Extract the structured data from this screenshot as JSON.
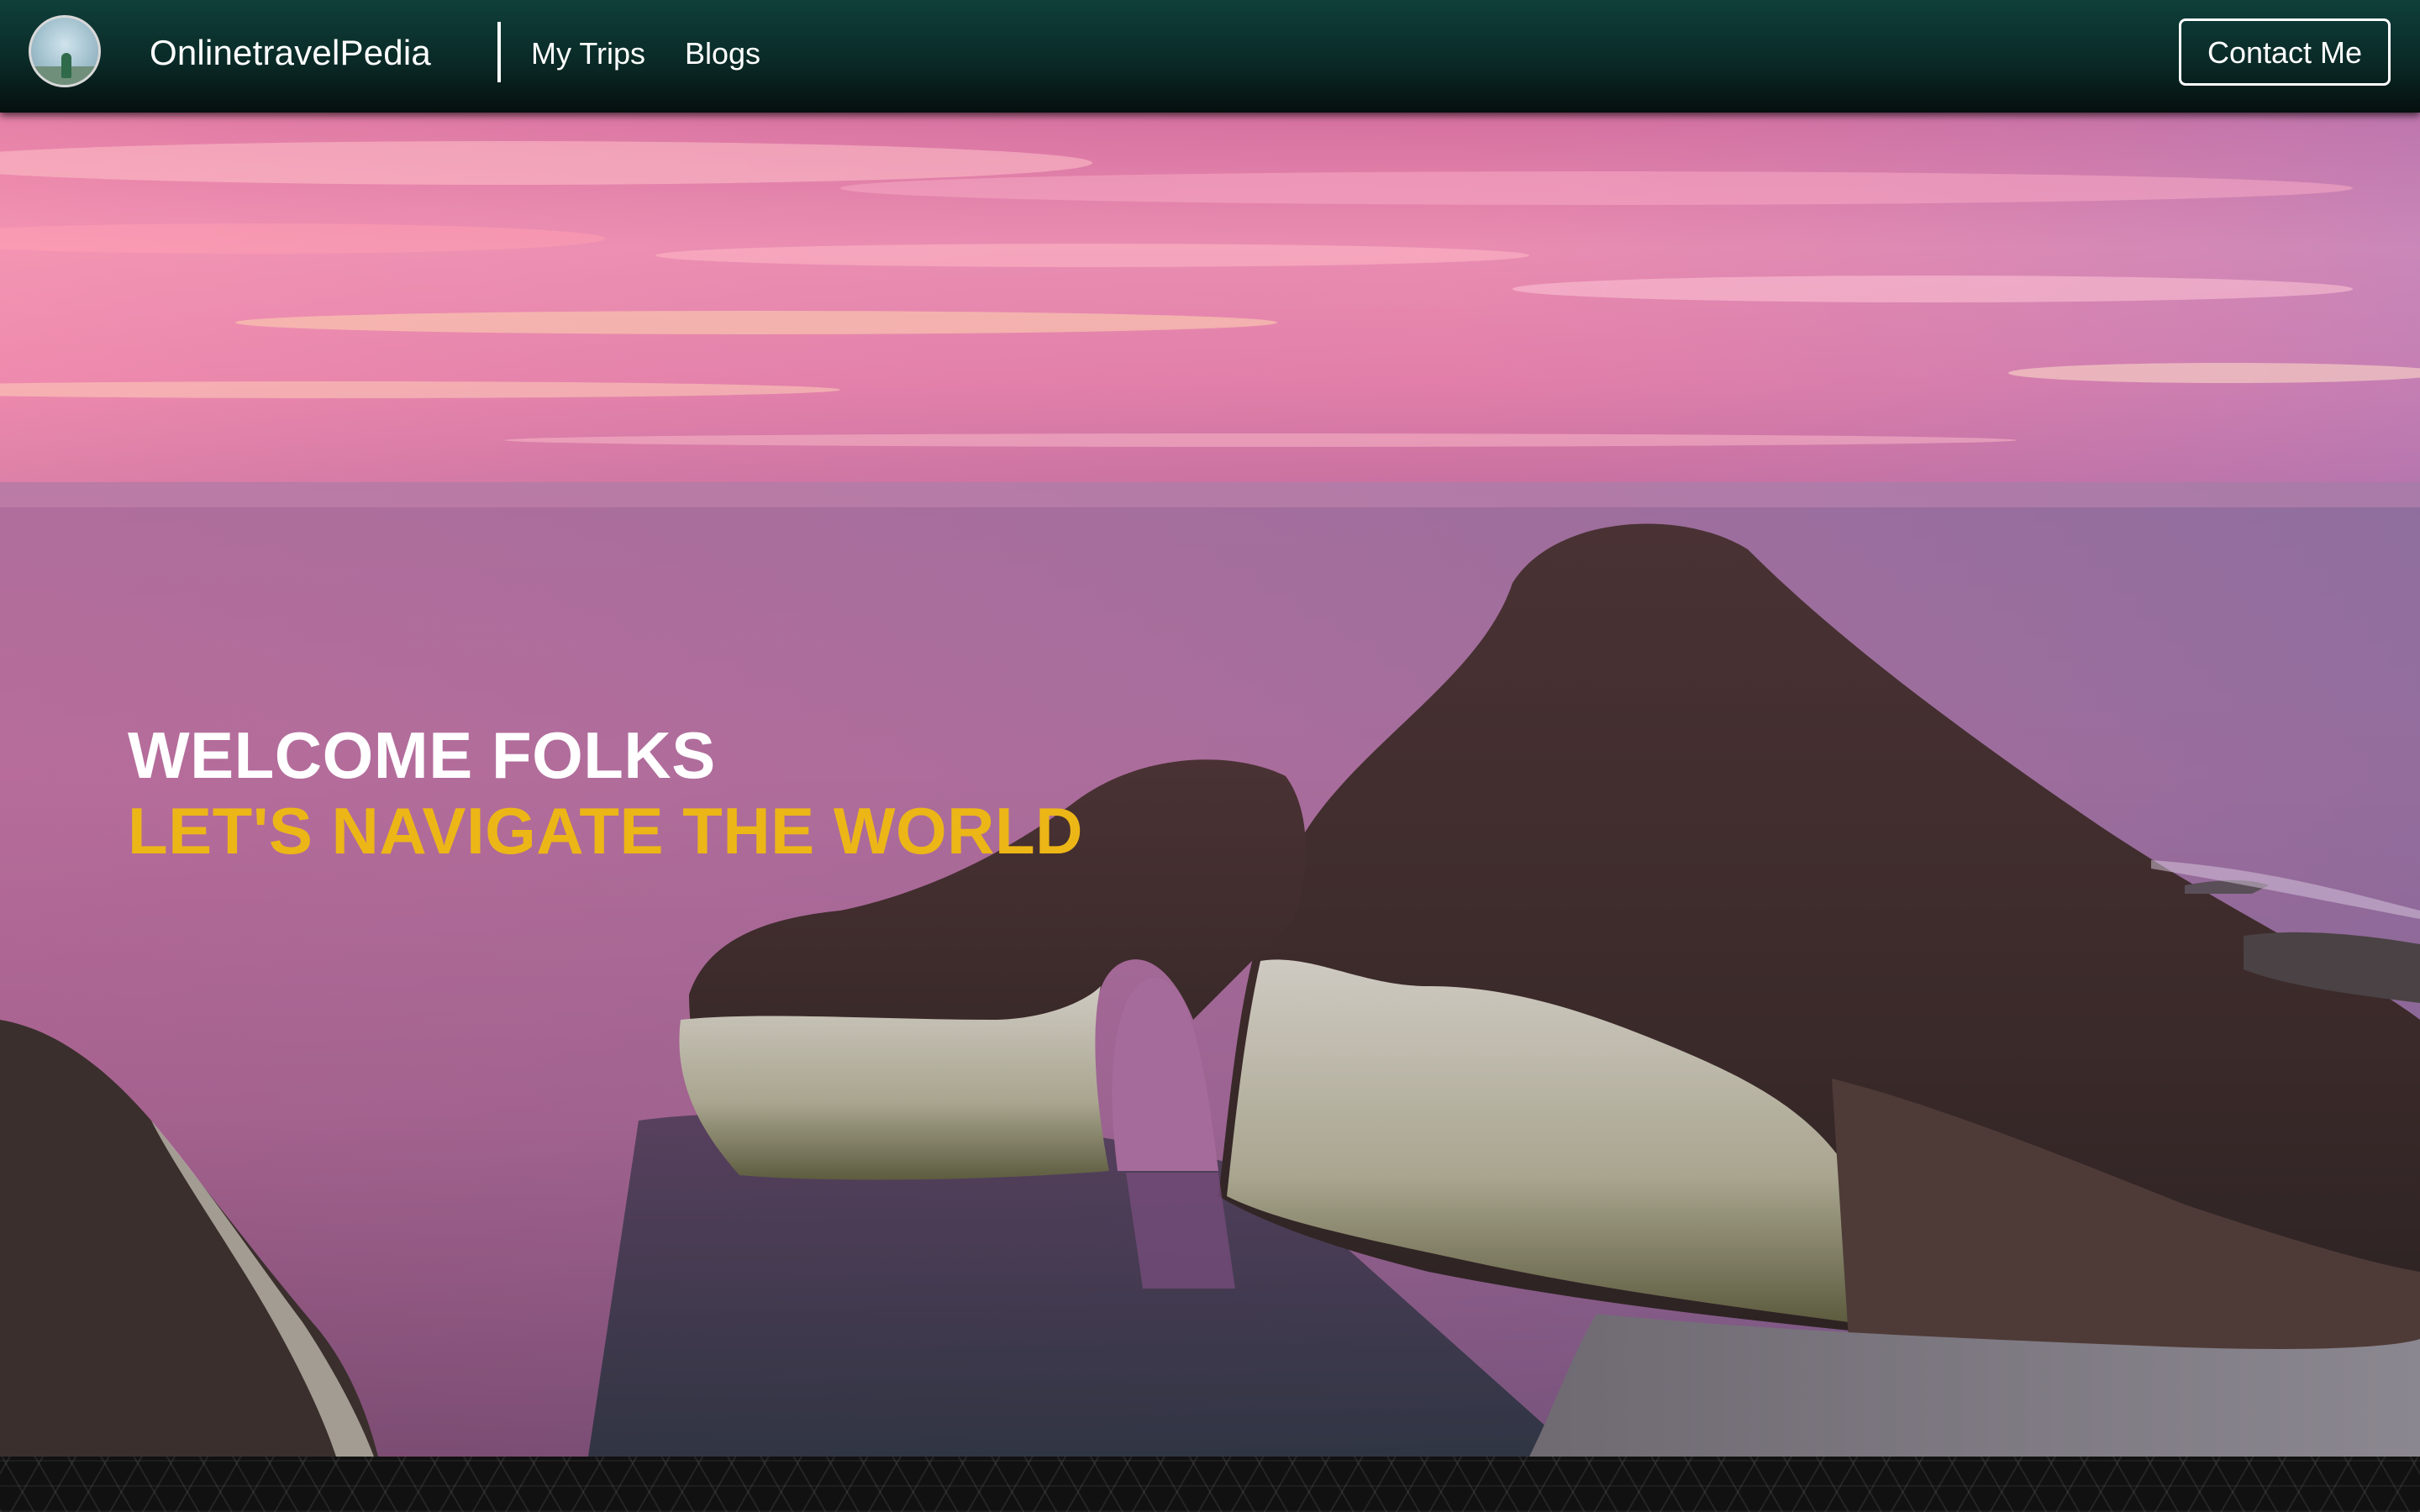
{
  "navbar": {
    "brand": "OnlinetravelPedia",
    "links": [
      {
        "label": "My Trips"
      },
      {
        "label": "Blogs"
      }
    ],
    "contact_label": "Contact Me"
  },
  "hero": {
    "line1": "WELCOME FOLKS",
    "line2": "LET'S NAVIGATE THE WORLD"
  },
  "colors": {
    "navbar": "#0f3f3a",
    "accent_text": "#ecb617",
    "sky_pink": "#e77aa3",
    "sea_purple": "#9b5e8e"
  }
}
